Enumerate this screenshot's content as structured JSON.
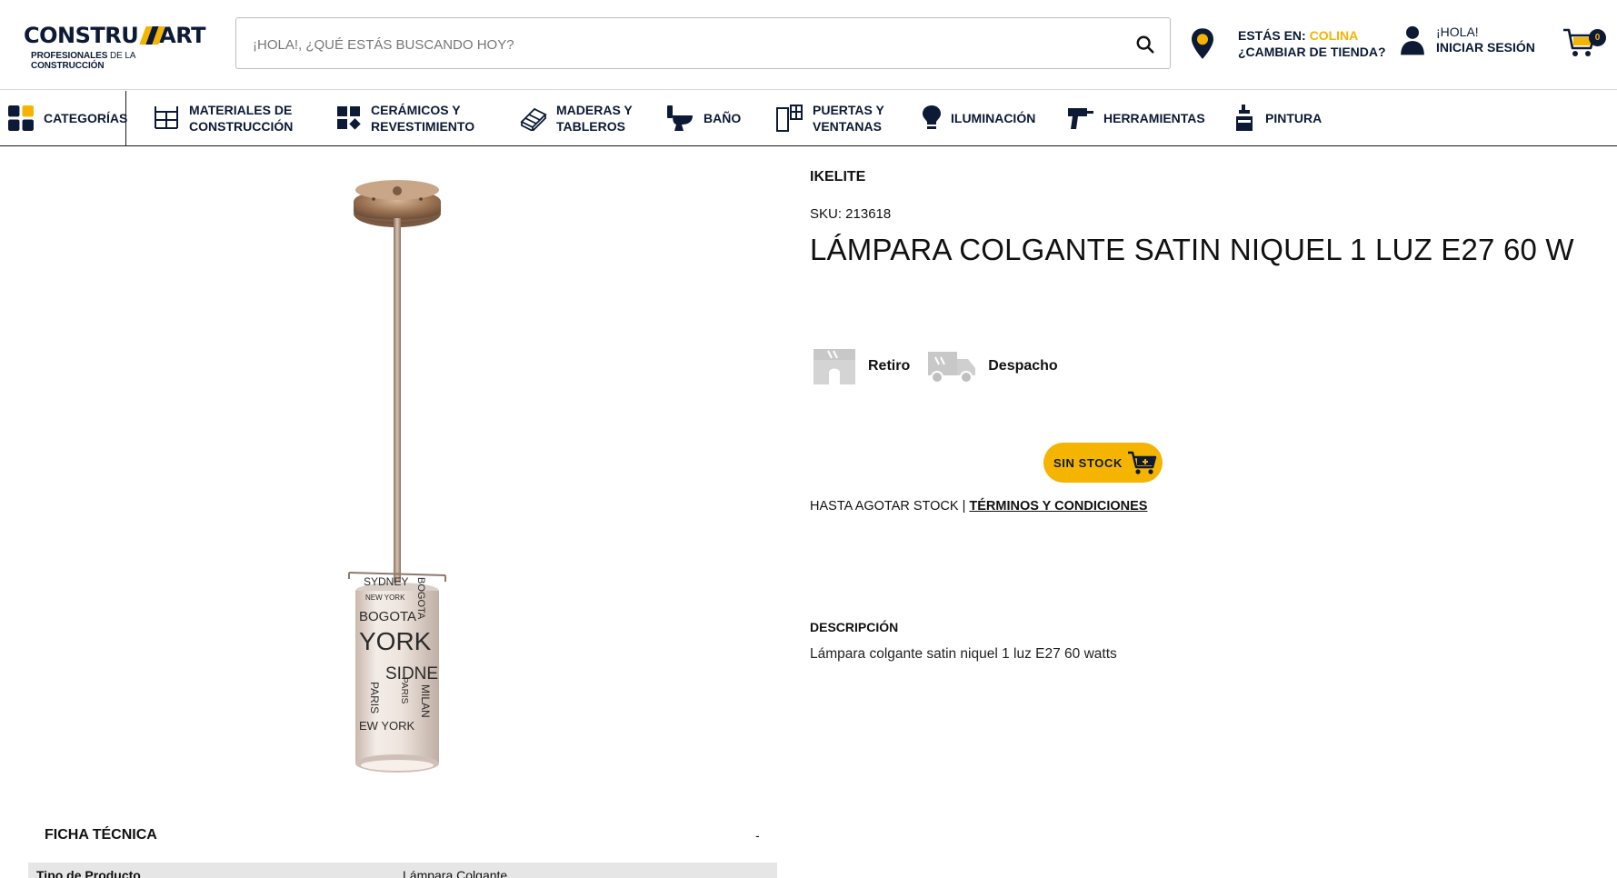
{
  "header": {
    "logo_text_left": "CONSTRU",
    "logo_text_right": "ART",
    "logo_tagline_a": "PROFESIONALES",
    "logo_tagline_b": " DE LA ",
    "logo_tagline_c": "CONSTRUCCIÓN",
    "search_placeholder": "¡HOLA!, ¿QUÉ ESTÁS BUSCANDO HOY?",
    "store_prefix": "ESTÁS EN: ",
    "store_name": "COLINA",
    "store_change": "¿CAMBIAR DE TIENDA?",
    "greeting": "¡HOLA!",
    "login": "INICIAR SESIÓN",
    "cart_count": "0"
  },
  "nav": {
    "categories": "CATEGORÍAS",
    "items": [
      {
        "line1": "MATERIALES DE",
        "line2": "CONSTRUCCIÓN"
      },
      {
        "line1": "CERÁMICOS Y",
        "line2": "REVESTIMIENTO"
      },
      {
        "line1": "MADERAS Y",
        "line2": "TABLEROS"
      },
      {
        "line1": "BAÑO",
        "line2": ""
      },
      {
        "line1": "PUERTAS Y",
        "line2": "VENTANAS"
      },
      {
        "line1": "ILUMINACIÓN",
        "line2": ""
      },
      {
        "line1": "HERRAMIENTAS",
        "line2": ""
      },
      {
        "line1": "PINTURA",
        "line2": ""
      }
    ]
  },
  "product": {
    "brand": "IKELITE",
    "sku": "SKU: 213618",
    "title": "LÁMPARA COLGANTE SATIN NIQUEL 1 LUZ E27 60 W",
    "delivery": {
      "pickup": "Retiro",
      "shipping": "Despacho"
    },
    "stock_button": "SIN STOCK",
    "terms_text": "HASTA AGOTAR STOCK | ",
    "terms_link": "TÉRMINOS Y CONDICIONES",
    "description_heading": "DESCRIPCIÓN",
    "description": "Lámpara colgante satin niquel 1 luz E27 60 watts",
    "lamp_print": [
      "SYDNEY",
      "NEW YORK",
      "BOGOTA",
      "YORK",
      "SIDNE",
      "PARIS",
      "BOGOTA",
      "MILAN",
      "PARIS",
      "EW YORK"
    ]
  },
  "ficha": {
    "heading": "FICHA TÉCNICA",
    "toggle": "-",
    "rows": [
      {
        "key": "Tipo de Producto",
        "value": "Lámpara Colgante"
      }
    ]
  },
  "colors": {
    "brand_yellow": "#f5b400",
    "brand_navy": "#0c1a35"
  }
}
